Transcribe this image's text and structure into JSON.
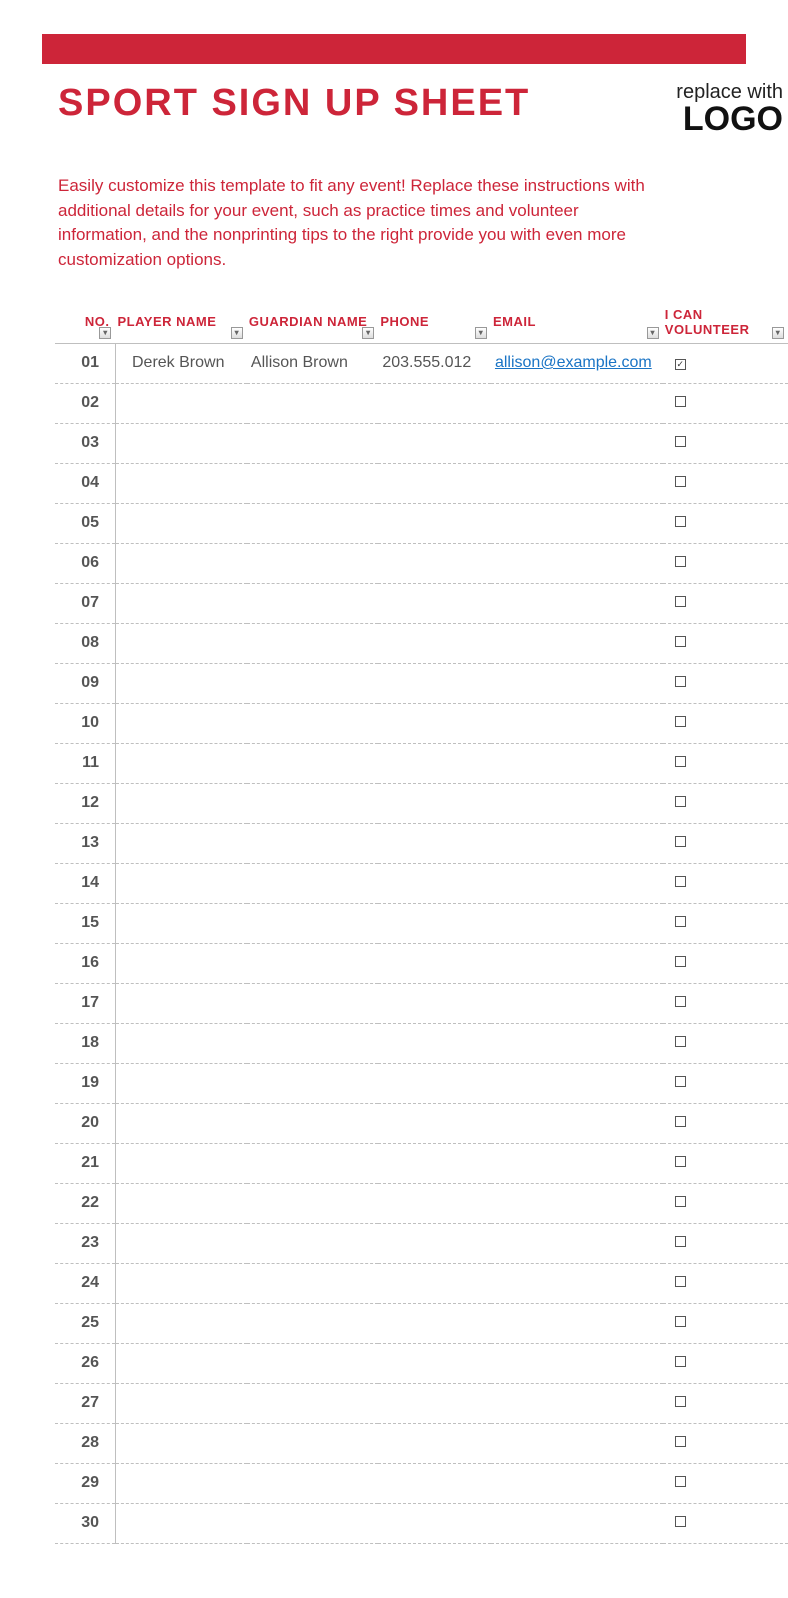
{
  "colors": {
    "accent": "#cd2539"
  },
  "header": {
    "title": "SPORT SIGN UP SHEET",
    "logo_top": "replace with",
    "logo_bottom": "LOGO"
  },
  "instructions": "Easily customize this template to fit any event! Replace these instructions with additional details for your event, such as practice times and volunteer information, and the nonprinting tips to the right provide you with even more customization options.",
  "columns": {
    "no": "NO.",
    "player": "PLAYER NAME",
    "guardian": "GUARDIAN NAME",
    "phone": "PHONE",
    "email": "EMAIL",
    "volunteer": "I CAN VOLUNTEER"
  },
  "rows": [
    {
      "no": "01",
      "player": "Derek Brown",
      "guardian": "Allison Brown",
      "phone": "203.555.012",
      "email": "allison@example.com",
      "volunteer": true
    },
    {
      "no": "02",
      "player": "",
      "guardian": "",
      "phone": "",
      "email": "",
      "volunteer": false
    },
    {
      "no": "03",
      "player": "",
      "guardian": "",
      "phone": "",
      "email": "",
      "volunteer": false
    },
    {
      "no": "04",
      "player": "",
      "guardian": "",
      "phone": "",
      "email": "",
      "volunteer": false
    },
    {
      "no": "05",
      "player": "",
      "guardian": "",
      "phone": "",
      "email": "",
      "volunteer": false
    },
    {
      "no": "06",
      "player": "",
      "guardian": "",
      "phone": "",
      "email": "",
      "volunteer": false
    },
    {
      "no": "07",
      "player": "",
      "guardian": "",
      "phone": "",
      "email": "",
      "volunteer": false
    },
    {
      "no": "08",
      "player": "",
      "guardian": "",
      "phone": "",
      "email": "",
      "volunteer": false
    },
    {
      "no": "09",
      "player": "",
      "guardian": "",
      "phone": "",
      "email": "",
      "volunteer": false
    },
    {
      "no": "10",
      "player": "",
      "guardian": "",
      "phone": "",
      "email": "",
      "volunteer": false
    },
    {
      "no": "11",
      "player": "",
      "guardian": "",
      "phone": "",
      "email": "",
      "volunteer": false
    },
    {
      "no": "12",
      "player": "",
      "guardian": "",
      "phone": "",
      "email": "",
      "volunteer": false
    },
    {
      "no": "13",
      "player": "",
      "guardian": "",
      "phone": "",
      "email": "",
      "volunteer": false
    },
    {
      "no": "14",
      "player": "",
      "guardian": "",
      "phone": "",
      "email": "",
      "volunteer": false
    },
    {
      "no": "15",
      "player": "",
      "guardian": "",
      "phone": "",
      "email": "",
      "volunteer": false
    },
    {
      "no": "16",
      "player": "",
      "guardian": "",
      "phone": "",
      "email": "",
      "volunteer": false
    },
    {
      "no": "17",
      "player": "",
      "guardian": "",
      "phone": "",
      "email": "",
      "volunteer": false
    },
    {
      "no": "18",
      "player": "",
      "guardian": "",
      "phone": "",
      "email": "",
      "volunteer": false
    },
    {
      "no": "19",
      "player": "",
      "guardian": "",
      "phone": "",
      "email": "",
      "volunteer": false
    },
    {
      "no": "20",
      "player": "",
      "guardian": "",
      "phone": "",
      "email": "",
      "volunteer": false
    },
    {
      "no": "21",
      "player": "",
      "guardian": "",
      "phone": "",
      "email": "",
      "volunteer": false
    },
    {
      "no": "22",
      "player": "",
      "guardian": "",
      "phone": "",
      "email": "",
      "volunteer": false
    },
    {
      "no": "23",
      "player": "",
      "guardian": "",
      "phone": "",
      "email": "",
      "volunteer": false
    },
    {
      "no": "24",
      "player": "",
      "guardian": "",
      "phone": "",
      "email": "",
      "volunteer": false
    },
    {
      "no": "25",
      "player": "",
      "guardian": "",
      "phone": "",
      "email": "",
      "volunteer": false
    },
    {
      "no": "26",
      "player": "",
      "guardian": "",
      "phone": "",
      "email": "",
      "volunteer": false
    },
    {
      "no": "27",
      "player": "",
      "guardian": "",
      "phone": "",
      "email": "",
      "volunteer": false
    },
    {
      "no": "28",
      "player": "",
      "guardian": "",
      "phone": "",
      "email": "",
      "volunteer": false
    },
    {
      "no": "29",
      "player": "",
      "guardian": "",
      "phone": "",
      "email": "",
      "volunteer": false
    },
    {
      "no": "30",
      "player": "",
      "guardian": "",
      "phone": "",
      "email": "",
      "volunteer": false
    }
  ]
}
